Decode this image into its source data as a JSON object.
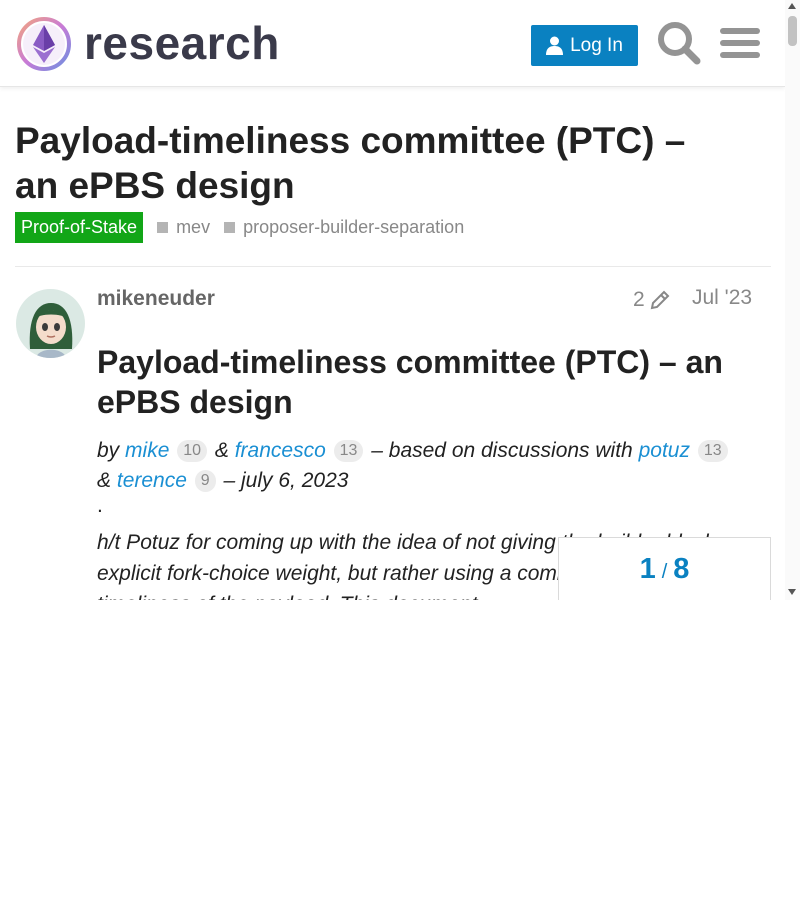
{
  "header": {
    "logo_text": "research",
    "login_label": "Log In"
  },
  "topic": {
    "title": "Payload-timeliness committee (PTC) – an ePBS design",
    "category": "Proof-of-Stake",
    "tags": [
      "mev",
      "proposer-builder-separation"
    ]
  },
  "post": {
    "username": "mikeneuder",
    "edit_count": "2",
    "date": "Jul '23",
    "heading": "Payload-timeliness committee (PTC) – an ePBS design",
    "byline": {
      "by": "by",
      "author1": "mike",
      "author1_badge": "10",
      "amp1": "&",
      "author2": "francesco",
      "author2_badge": "13",
      "based_on": "– based on discussions with",
      "author3": "potuz",
      "author3_badge": "13",
      "amp2": "&",
      "author4": "terence",
      "author4_badge": "9",
      "date": "– july 6, 2023"
    },
    "dot": ".",
    "body": "h/t Potuz for coming up with the idea of not giving the builder block explicit fork-choice weight, but rather using a committee to vote on the timeliness of the payload. This document"
  },
  "progress": {
    "current": "1",
    "separator": "/",
    "total": "8"
  },
  "colors": {
    "accent": "#0a81c1",
    "category": "#12a617",
    "link": "#1a8fd3"
  },
  "icons": [
    "user-icon",
    "search-icon",
    "hamburger-menu-icon",
    "pencil-icon",
    "ethereum-logo"
  ]
}
